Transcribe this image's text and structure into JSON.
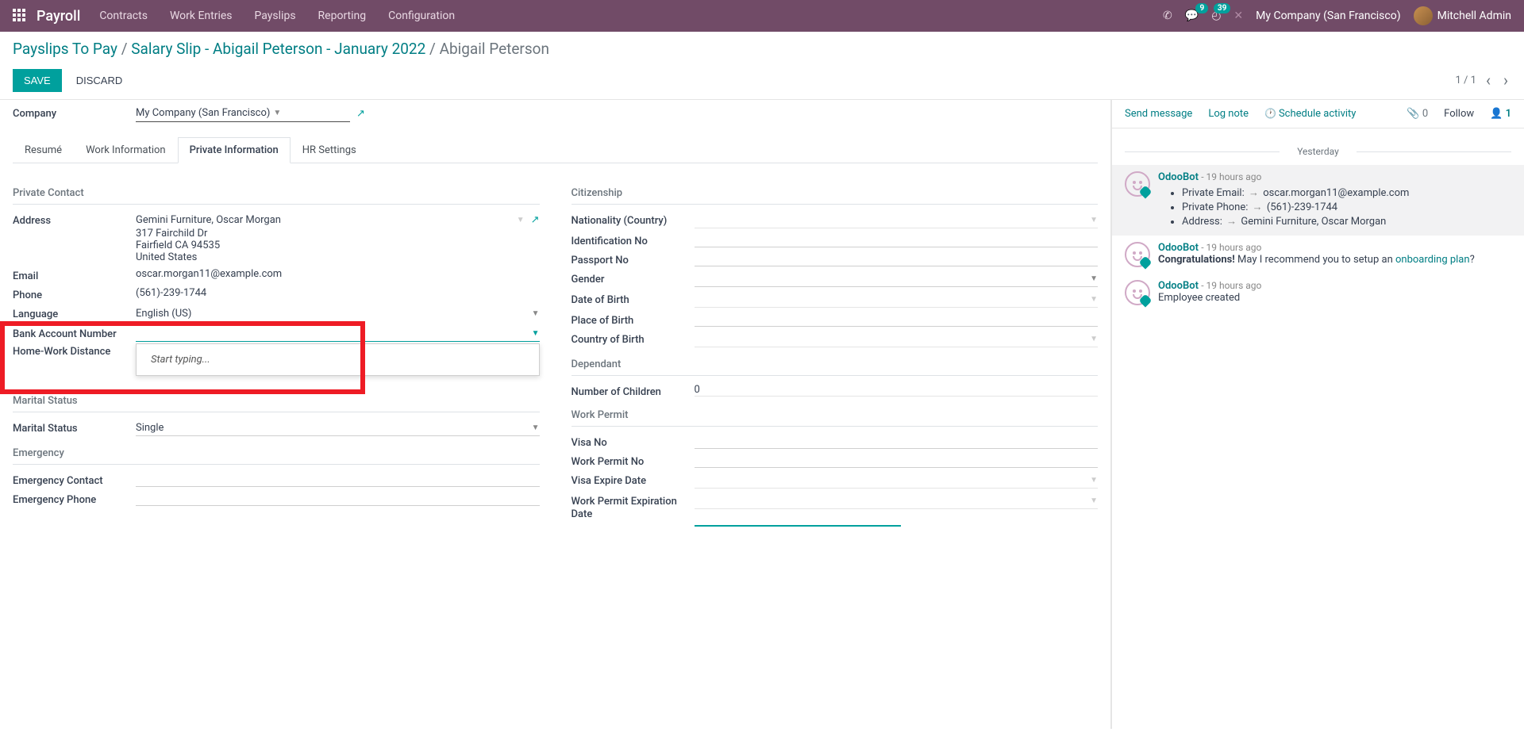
{
  "navbar": {
    "brand": "Payroll",
    "menu": [
      "Contracts",
      "Work Entries",
      "Payslips",
      "Reporting",
      "Configuration"
    ],
    "chat_badge": "9",
    "activity_badge": "39",
    "company": "My Company (San Francisco)",
    "user": "Mitchell Admin"
  },
  "breadcrumb": {
    "l1": "Payslips To Pay",
    "l2": "Salary Slip - Abigail Peterson - January 2022",
    "current": "Abigail Peterson"
  },
  "actions": {
    "save": "SAVE",
    "discard": "DISCARD"
  },
  "pager": {
    "pos": "1 / 1"
  },
  "company_field": {
    "label": "Company",
    "value": "My Company (San Francisco)"
  },
  "tabs": [
    "Resumé",
    "Work Information",
    "Private Information",
    "HR Settings"
  ],
  "active_tab": 2,
  "left": {
    "sec1": "Private Contact",
    "address_label": "Address",
    "address_value": "Gemini Furniture, Oscar Morgan",
    "address_lines": [
      "317 Fairchild Dr",
      "Fairfield CA 94535",
      "United States"
    ],
    "email_label": "Email",
    "email_value": "oscar.morgan11@example.com",
    "phone_label": "Phone",
    "phone_value": "(561)-239-1744",
    "lang_label": "Language",
    "lang_value": "English (US)",
    "bank_label": "Bank Account Number",
    "bank_placeholder": "Start typing...",
    "dist_label": "Home-Work Distance",
    "sec2": "Marital Status",
    "marital_label": "Marital Status",
    "marital_value": "Single",
    "sec3": "Emergency",
    "em_contact_label": "Emergency Contact",
    "em_phone_label": "Emergency Phone"
  },
  "right": {
    "sec1": "Citizenship",
    "nat_label": "Nationality (Country)",
    "id_label": "Identification No",
    "pass_label": "Passport No",
    "gender_label": "Gender",
    "dob_label": "Date of Birth",
    "pob_label": "Place of Birth",
    "cob_label": "Country of Birth",
    "sec2": "Dependant",
    "children_label": "Number of Children",
    "children_value": "0",
    "sec3": "Work Permit",
    "visa_label": "Visa No",
    "wpn_label": "Work Permit No",
    "ved_label": "Visa Expire Date",
    "wped_label": "Work Permit Expiration Date"
  },
  "chatter": {
    "send": "Send message",
    "log": "Log note",
    "activity": "Schedule activity",
    "attach_count": "0",
    "follow": "Follow",
    "followers": "1",
    "day": "Yesterday",
    "msgs": [
      {
        "from": "OdooBot",
        "time": "- 19 hours ago",
        "lines": [
          {
            "label": "Private Email:",
            "value": "oscar.morgan11@example.com"
          },
          {
            "label": "Private Phone:",
            "value": "(561)-239-1744"
          },
          {
            "label": "Address:",
            "value": "Gemini Furniture, Oscar Morgan"
          }
        ]
      },
      {
        "from": "OdooBot",
        "time": "- 19 hours ago",
        "text_a": "Congratulations!",
        "text_b": " May I recommend you to setup an ",
        "link": "onboarding plan",
        "text_c": "?"
      },
      {
        "from": "OdooBot",
        "time": "- 19 hours ago",
        "text": "Employee created"
      }
    ]
  }
}
